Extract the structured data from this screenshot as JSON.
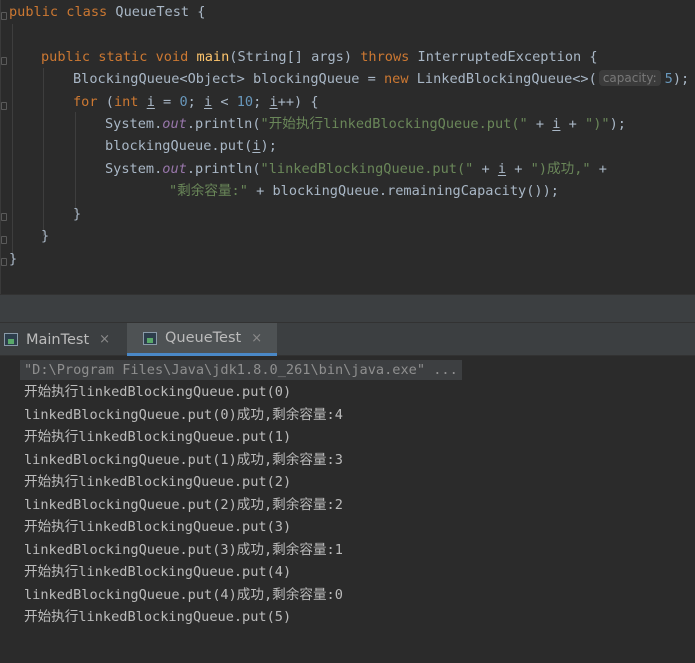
{
  "colors": {
    "editor_bg": "#2b2b2b",
    "keyword": "#cc7832",
    "method_decl": "#ffc66d",
    "string": "#6a8759",
    "number": "#6897bb",
    "static_field": "#9876aa",
    "default_text": "#a9b7c6",
    "console_text": "#bbbbbb",
    "tab_accent": "#4a88c7"
  },
  "code": {
    "line1": {
      "kw_public": "public",
      "kw_class": "class",
      "name": "QueueTest",
      "brace": "{"
    },
    "line2": {
      "kw_public": "public",
      "kw_static": "static",
      "kw_void": "void",
      "method": "main",
      "params": "(String[] args)",
      "kw_throws": "throws",
      "exception": "InterruptedException {"
    },
    "line3": {
      "decl": "BlockingQueue<Object> blockingQueue = ",
      "kw_new": "new",
      "ctor": "LinkedBlockingQueue<>(",
      "hint": "capacity:",
      "num": "5",
      "end": ");"
    },
    "line4": {
      "kw_for": "for",
      "paren": "(",
      "kw_int": "int",
      "var1": "i",
      "eq": " = ",
      "zero": "0",
      "semi1": "; ",
      "var2": "i",
      "lt": " < ",
      "ten": "10",
      "semi2": "; ",
      "var3": "i",
      "end": "++) {"
    },
    "line5": {
      "sys": "System.",
      "out": "out",
      "call": ".println(",
      "str1": "\"开始执行linkedBlockingQueue.put(\"",
      "plus": " + ",
      "var": "i",
      "plus2": " + ",
      "str2": "\")\"",
      "end": ");"
    },
    "line6": {
      "pre": "blockingQueue.put(",
      "var": "i",
      "end": ");"
    },
    "line7": {
      "sys": "System.",
      "out": "out",
      "call": ".println(",
      "str1": "\"linkedBlockingQueue.put(\"",
      "plus": " + ",
      "var": "i",
      "plus2": " + ",
      "str2": "\")成功,\"",
      "end": " +"
    },
    "line8": {
      "str": "\"剩余容量:\"",
      "rest": " + blockingQueue.remainingCapacity());"
    },
    "line9": "}",
    "line10": "}",
    "line11": "}"
  },
  "tabs": [
    {
      "label": "MainTest",
      "close": "×"
    },
    {
      "label": "QueueTest",
      "close": "×"
    }
  ],
  "console": {
    "command": "\"D:\\Program Files\\Java\\jdk1.8.0_261\\bin\\java.exe\" ...",
    "lines": [
      "开始执行linkedBlockingQueue.put(0)",
      "linkedBlockingQueue.put(0)成功,剩余容量:4",
      "开始执行linkedBlockingQueue.put(1)",
      "linkedBlockingQueue.put(1)成功,剩余容量:3",
      "开始执行linkedBlockingQueue.put(2)",
      "linkedBlockingQueue.put(2)成功,剩余容量:2",
      "开始执行linkedBlockingQueue.put(3)",
      "linkedBlockingQueue.put(3)成功,剩余容量:1",
      "开始执行linkedBlockingQueue.put(4)",
      "linkedBlockingQueue.put(4)成功,剩余容量:0",
      "开始执行linkedBlockingQueue.put(5)"
    ]
  }
}
